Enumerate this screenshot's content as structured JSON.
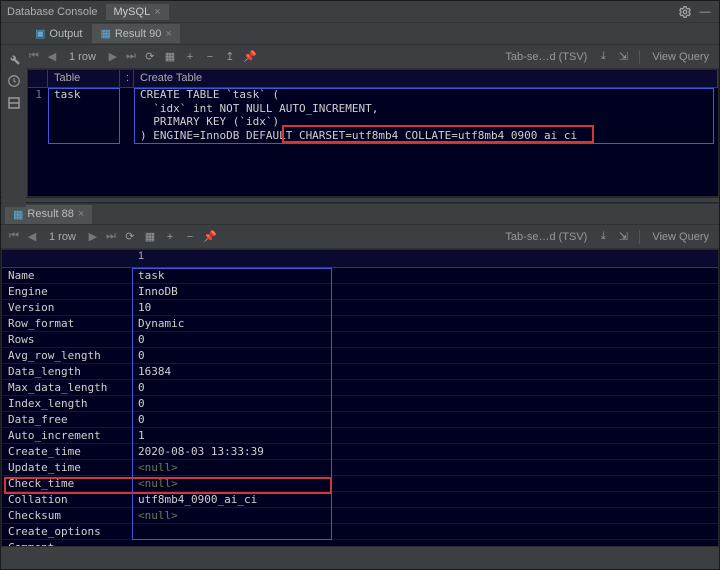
{
  "titlebar": {
    "label": "Database Console",
    "tab": "MySQL"
  },
  "top": {
    "outputTab": "Output",
    "resultTab": "Result 90",
    "rowLabel": "1 row",
    "exportLabel": "Tab-se…d (TSV)",
    "viewQuery": "View Query",
    "headers": {
      "table": "Table",
      "divider": ":",
      "create": "Create Table"
    },
    "row": {
      "num": "1",
      "table": "task",
      "lines": [
        "CREATE TABLE `task` (",
        "  `idx` int NOT NULL AUTO_INCREMENT,",
        "  PRIMARY KEY (`idx`)",
        ") ENGINE=InnoDB DEFAULT CHARSET=utf8mb4 COLLATE=utf8mb4_0900_ai_ci"
      ]
    }
  },
  "bottom": {
    "tab": "Result 88",
    "rowLabel": "1 row",
    "exportLabel": "Tab-se…d (TSV)",
    "viewQuery": "View Query",
    "colHeader": "1",
    "rows": [
      {
        "k": "Name",
        "v": "task"
      },
      {
        "k": "Engine",
        "v": "InnoDB"
      },
      {
        "k": "Version",
        "v": "10"
      },
      {
        "k": "Row_format",
        "v": "Dynamic"
      },
      {
        "k": "Rows",
        "v": "0"
      },
      {
        "k": "Avg_row_length",
        "v": "0"
      },
      {
        "k": "Data_length",
        "v": "16384"
      },
      {
        "k": "Max_data_length",
        "v": "0"
      },
      {
        "k": "Index_length",
        "v": "0"
      },
      {
        "k": "Data_free",
        "v": "0"
      },
      {
        "k": "Auto_increment",
        "v": "1"
      },
      {
        "k": "Create_time",
        "v": "2020-08-03 13:33:39"
      },
      {
        "k": "Update_time",
        "v": "<null>",
        "null": true
      },
      {
        "k": "Check_time",
        "v": "<null>",
        "null": true
      },
      {
        "k": "Collation",
        "v": "utf8mb4_0900_ai_ci"
      },
      {
        "k": "Checksum",
        "v": "<null>",
        "null": true
      },
      {
        "k": "Create_options",
        "v": ""
      },
      {
        "k": "Comment",
        "v": ""
      }
    ]
  }
}
